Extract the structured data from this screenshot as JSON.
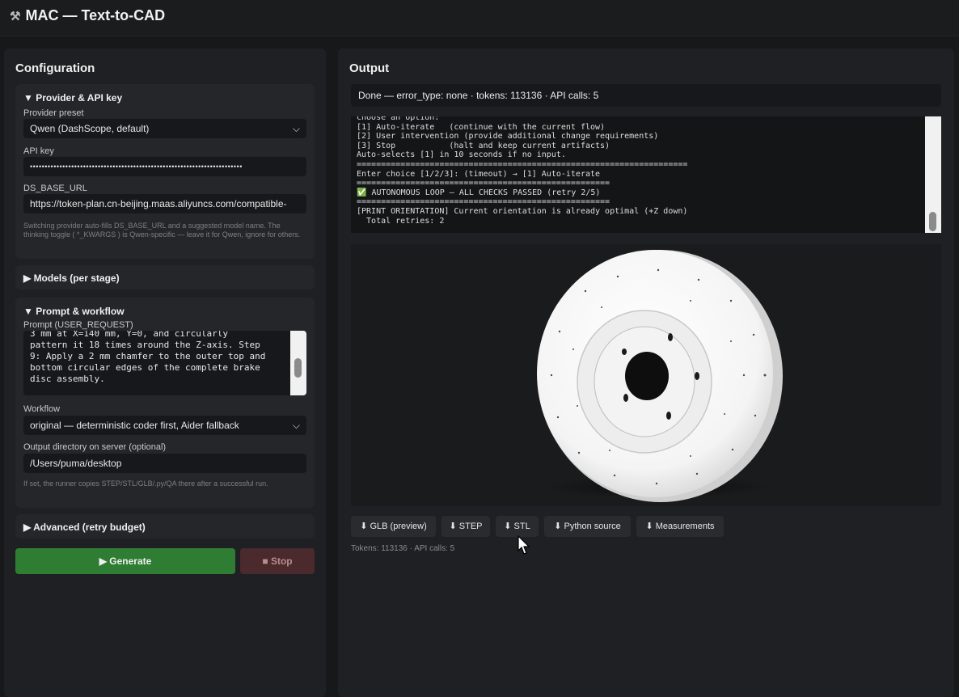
{
  "app": {
    "title": "MAC — Text-to-CAD",
    "icon": "hammer-wrench-icon"
  },
  "left": {
    "title": "Configuration",
    "provider_section": {
      "header": "▼ Provider & API key",
      "preset_label": "Provider preset",
      "preset_value": "Qwen (DashScope, default)",
      "api_key_label": "API key",
      "api_key_value": "••••••••••••••••••••••••••••••••••••••••••••••••••••••••••••••••••••••••",
      "base_url_label": "DS_BASE_URL",
      "base_url_value": "https://token-plan.cn-beijing.maas.aliyuncs.com/compatible-",
      "hint": "Switching provider auto-fills DS_BASE_URL and a suggested model name. The thinking toggle ( *_KWARGS ) is Qwen-specific — leave it for Qwen, ignore for others."
    },
    "models_section": {
      "header": "▶ Models (per stage)"
    },
    "prompt_section": {
      "header": "▼ Prompt & workflow",
      "prompt_label": "Prompt (USER_REQUEST)",
      "prompt_value": "3 mm at X=140 mm, Y=0, and circularly\npattern it 18 times around the Z-axis. Step\n9: Apply a 2 mm chamfer to the outer top and\nbottom circular edges of the complete brake\ndisc assembly.",
      "workflow_label": "Workflow",
      "workflow_value": "original — deterministic coder first, Aider fallback",
      "outdir_label": "Output directory on server (optional)",
      "outdir_value": "/Users/puma/desktop",
      "hint": "If set, the runner copies STEP/STL/GLB/.py/QA there after a successful run."
    },
    "advanced_section": {
      "header": "▶ Advanced (retry budget)"
    },
    "generate_label": "▶ Generate",
    "stop_label": "■ Stop"
  },
  "right": {
    "title": "Output",
    "status": "Done — error_type: none · tokens: 113136 · API calls: 5",
    "log": "choose an option:\n[1] Auto-iterate   (continue with the current flow)\n[2] User intervention (provide additional change requirements)\n[3] Stop           (halt and keep current artifacts)\nAuto-selects [1] in 10 seconds if no input.\n====================================================================\nEnter choice [1/2/3]: (timeout) → [1] Auto-iterate\n====================================================\n✅ AUTONOMOUS LOOP — ALL CHECKS PASSED (retry 2/5)\n====================================================\n[PRINT ORIENTATION] Current orientation is already optimal (+Z down)\n  Total retries: 2",
    "downloads": [
      "⬇ GLB (preview)",
      "⬇ STEP",
      "⬇ STL",
      "⬇ Python source",
      "⬇ Measurements"
    ],
    "tokens_line": "Tokens: 113136 · API calls: 5"
  }
}
